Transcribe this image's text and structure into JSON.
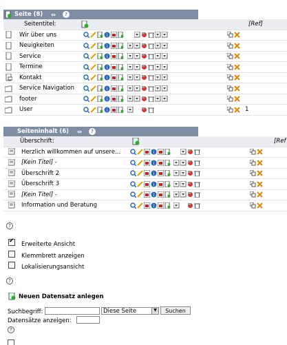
{
  "pages_panel": {
    "title": "Seite (8)",
    "field_label": "Seitentitel:",
    "ref": "[Ref]",
    "rows": [
      {
        "label": "Wir über uns",
        "icon": "page-icon"
      },
      {
        "label": "Neuigkeiten",
        "icon": "page-icon"
      },
      {
        "label": "Service",
        "icon": "page-icon"
      },
      {
        "label": "Termine",
        "icon": "page-icon"
      },
      {
        "label": "Kontakt",
        "icon": "page-mail-icon"
      },
      {
        "label": "Service Navigation",
        "icon": "folder-icon"
      },
      {
        "label": "footer",
        "icon": "folder-icon"
      },
      {
        "label": "User",
        "icon": "folder-icon",
        "count": "1"
      }
    ]
  },
  "content_panel": {
    "title": "Seiteninhalt (6)",
    "field_label": "Überschrift:",
    "ref": "[Ref",
    "rows": [
      {
        "label": "Herzlich willkommen auf unsere...",
        "italic": false
      },
      {
        "label": "[Kein Titel] -",
        "italic": true
      },
      {
        "label": "Überschrift 2",
        "italic": false
      },
      {
        "label": "Überschrift 3",
        "italic": false
      },
      {
        "label": "[Kein Titel] -",
        "italic": true
      },
      {
        "label": "Information und Beratung",
        "italic": false
      }
    ]
  },
  "options": {
    "extended_view": "Erweiterte Ansicht",
    "clipboard": "Klemmbrett anzeigen",
    "localization": "Lokalisierungsansicht"
  },
  "new_record": {
    "label": "Neuen Datensatz anlegen"
  },
  "search": {
    "term_label": "Suchbegriff:",
    "scope_value": "Diese Seite",
    "button_label": "Suchen",
    "records_label": "Datensätze anzeigen:"
  },
  "help_mark": "?",
  "colors": {
    "header_bg": "#7f8da4",
    "sub_bg": "#ecedf0"
  }
}
